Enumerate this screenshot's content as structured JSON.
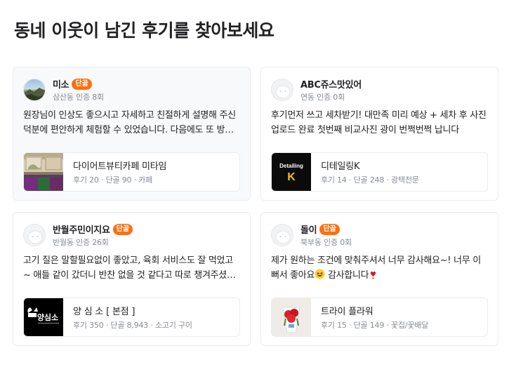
{
  "page_title": "동네 이웃이 남긴 후기를 찾아보세요",
  "reviews": [
    {
      "user_name": "미소",
      "badge": "단골",
      "user_meta": "삼산동 인증 8회",
      "avatar": "landscape-photo",
      "text": "원장님이 인상도 좋으시고 자세하고 친절하게 설명해 주신 덕분에 편안하게 체험할 수 있었습니다. 다음에도 또 방문하고 싶어요",
      "business": {
        "name": "다이어트뷰티카페 미타임",
        "meta": "후기 20 · 단골 90 · 카페",
        "thumb": "cafe-interior-photo"
      }
    },
    {
      "user_name": "ABC쥬스맛있어",
      "badge": "",
      "user_meta": "연동 인증 0회",
      "avatar": "default-avatar",
      "text": "후기먼저 쓰고 세차받기! 대만족 미리 예상 + 세차 후 사진 업로드 완료 첫번째 비교사진 광이 번쩍번쩍 납니다",
      "business": {
        "name": "디테일링K",
        "meta": "후기 14 · 단골 248 · 광택전문",
        "thumb": "detailing-logo",
        "thumb_text": "Detailing",
        "thumb_letter": "K"
      }
    },
    {
      "user_name": "반월주민이지요",
      "badge": "단골",
      "user_meta": "반월동 인증 26회",
      "avatar": "default-avatar",
      "text": "고기 질은 말할필요없이 좋았고, 육회 서비스도 잘 먹었고~ 애들 같이 갔더니 반찬 없을 것 같다고 따로 챙겨주셨어요",
      "business": {
        "name": "양 심 소 [ 본점 ]",
        "meta": "후기 350 · 단골 8,943 · 소고기 구이",
        "thumb": "yangsimso-logo",
        "thumb_text": "양심소"
      }
    },
    {
      "user_name": "돌이",
      "badge": "단골",
      "user_meta": "북부동 인증 0회",
      "avatar": "default-avatar",
      "text": "제가 원하는 조건에 맞춰주셔서 너무 감사해요~! 너무 이뻐서 좋아요",
      "text_tail": " 감사합니다",
      "business": {
        "name": "트라이 플라워",
        "meta": "후기 15 · 단골 149 · 꽃집/꽃배달",
        "thumb": "flower-bouquet-photo"
      }
    }
  ],
  "colors": {
    "accent": "#ff6f0f",
    "muted_text": "#868b94",
    "border": "#e9ecef"
  }
}
